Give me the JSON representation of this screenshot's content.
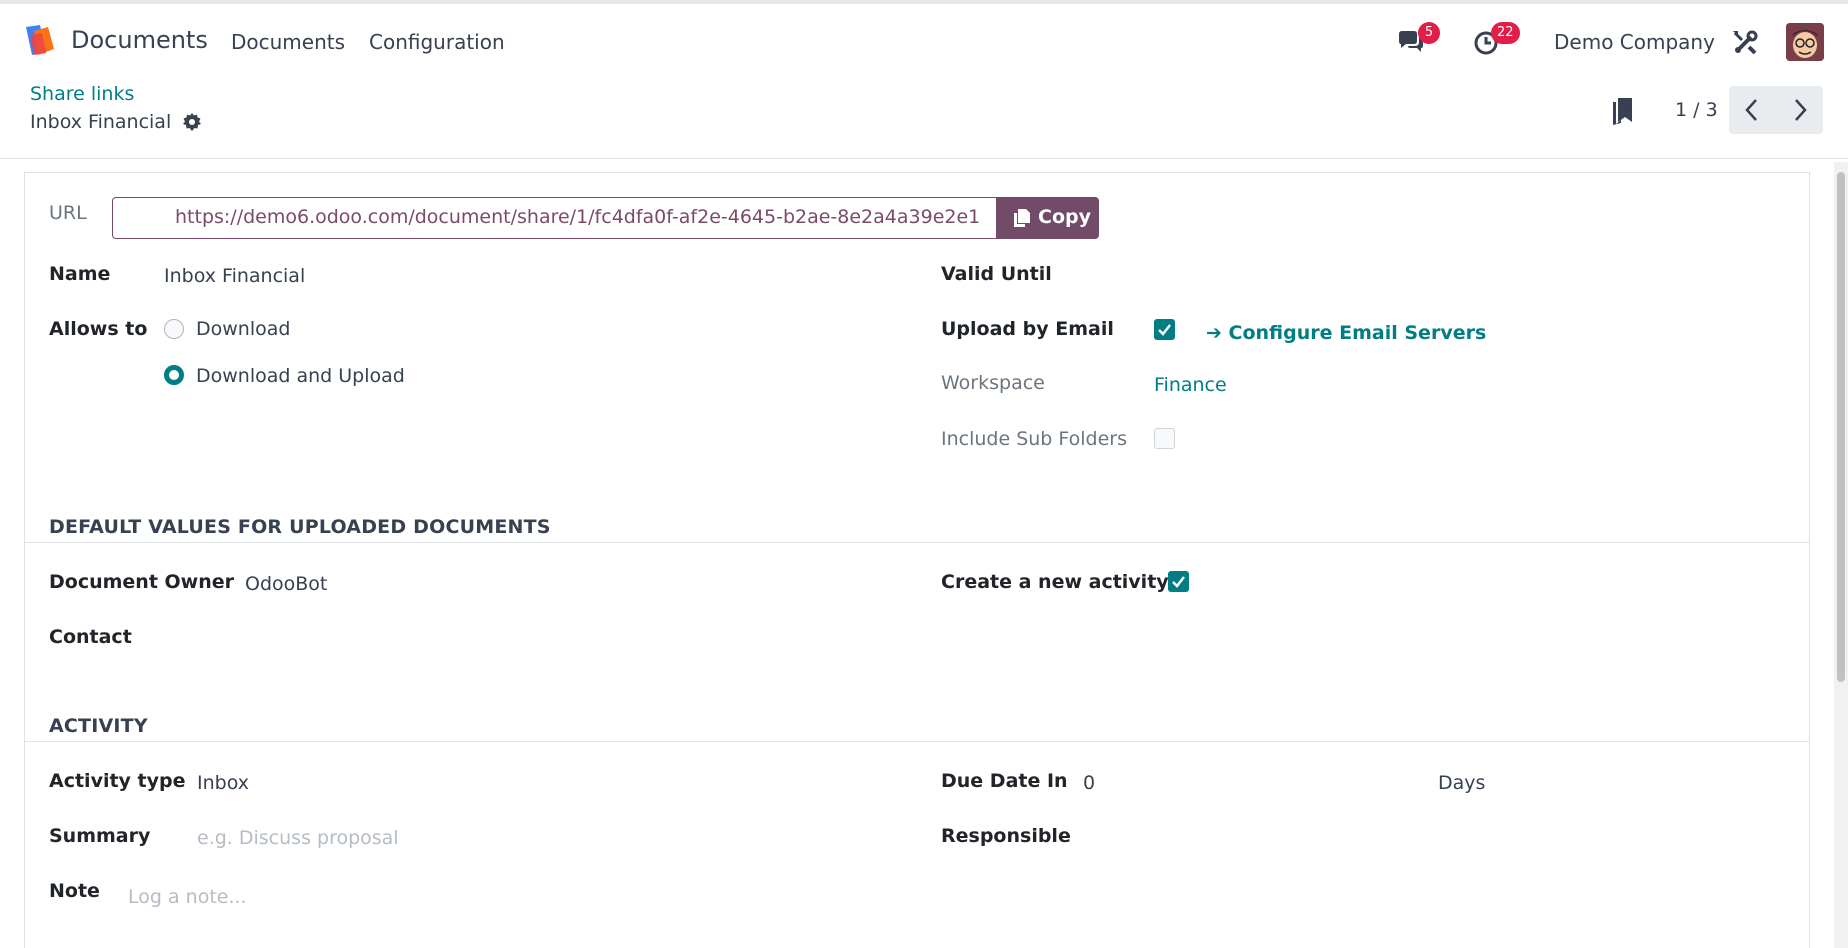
{
  "navbar": {
    "app_name": "Documents",
    "menu": [
      "Documents",
      "Configuration"
    ],
    "messages_count": "5",
    "activities_count": "22",
    "company": "Demo Company"
  },
  "control_panel": {
    "breadcrumb": "Share links",
    "record_title": "Inbox Financial",
    "pager": "1 / 3"
  },
  "form": {
    "url_label": "URL",
    "url_value": "https://demo6.odoo.com/document/share/1/fc4dfa0f-af2e-4645-b2ae-8e2a4a39e2e1",
    "copy_label": "Copy",
    "name_label": "Name",
    "name_value": "Inbox Financial",
    "allows_label": "Allows to",
    "allows_options": [
      {
        "label": "Download",
        "checked": false
      },
      {
        "label": "Download and Upload",
        "checked": true
      }
    ],
    "valid_until_label": "Valid Until",
    "upload_email_label": "Upload by Email",
    "upload_email_checked": true,
    "configure_link": "➔ Configure Email Servers",
    "workspace_label": "Workspace",
    "workspace_value": "Finance",
    "subfolders_label": "Include Sub Folders",
    "subfolders_checked": false
  },
  "defaults_section": {
    "title": "DEFAULT VALUES FOR UPLOADED DOCUMENTS",
    "owner_label": "Document Owner",
    "owner_value": "OdooBot",
    "contact_label": "Contact",
    "create_activity_label": "Create a new activity",
    "create_activity_checked": true
  },
  "activity_section": {
    "title": "ACTIVITY",
    "type_label": "Activity type",
    "type_value": "Inbox",
    "summary_label": "Summary",
    "summary_placeholder": "e.g. Discuss proposal",
    "note_label": "Note",
    "note_placeholder": "Log a note...",
    "due_label": "Due Date In",
    "due_value": "0",
    "due_unit": "Days",
    "responsible_label": "Responsible"
  },
  "colors": {
    "brand": "#714b67",
    "accent": "#017e84",
    "badge": "#e11d48"
  }
}
